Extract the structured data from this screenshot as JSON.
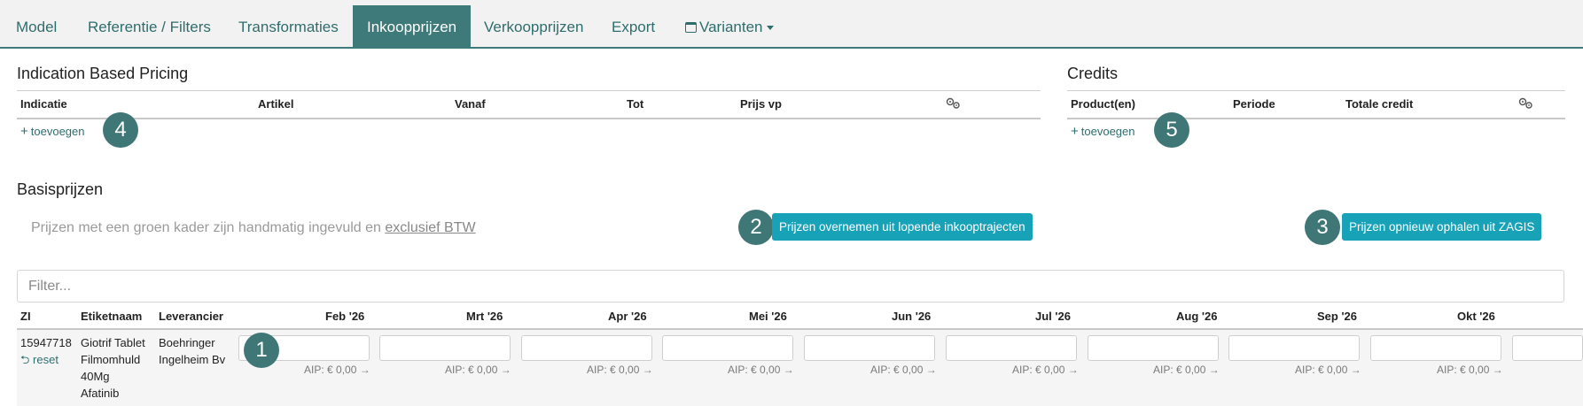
{
  "tabs": [
    {
      "label": "Model",
      "active": false
    },
    {
      "label": "Referentie / Filters",
      "active": false
    },
    {
      "label": "Transformaties",
      "active": false
    },
    {
      "label": "Inkoopprijzen",
      "active": true
    },
    {
      "label": "Verkoopprijzen",
      "active": false
    },
    {
      "label": "Export",
      "active": false
    },
    {
      "label": "Varianten",
      "active": false,
      "icon": "calendar-icon",
      "dropdown": true
    }
  ],
  "ibp": {
    "title": "Indication Based Pricing",
    "columns": [
      "Indicatie",
      "Artikel",
      "Vanaf",
      "Tot",
      "Prijs vp"
    ],
    "settings_icon": "gears-icon",
    "add_label": "toevoegen",
    "badge": "4"
  },
  "credits": {
    "title": "Credits",
    "columns": [
      "Product(en)",
      "Periode",
      "Totale credit"
    ],
    "settings_icon": "gears-icon",
    "add_label": "toevoegen",
    "badge": "5"
  },
  "basis": {
    "title": "Basisprijzen",
    "note_prefix": "Prijzen met een groen kader zijn handmatig ingevuld en ",
    "note_link": "exclusief BTW",
    "btn_overnemen": "Prijzen overnemen uit lopende inkooptrajecten",
    "btn_overnemen_badge": "2",
    "btn_zagis": "Prijzen opnieuw ophalen uit ZAGIS",
    "btn_zagis_badge": "3",
    "filter_placeholder": "Filter...",
    "columns": [
      "ZI",
      "Etiketnaam",
      "Leverancier"
    ],
    "months": [
      "Feb '26",
      "Mrt '26",
      "Apr '26",
      "Mei '26",
      "Jun '26",
      "Jul '26",
      "Aug '26",
      "Sep '26",
      "Okt '26"
    ],
    "row": {
      "zi": "15947718",
      "reset_label": "reset",
      "etiket_lines": [
        "Giotrif Tablet",
        "Filmomhuld",
        "40Mg",
        "Afatinib"
      ],
      "leverancier_lines": [
        "Boehringer",
        "Ingelheim Bv"
      ],
      "aip_label": "AIP: € 0,00",
      "row_badge": "1"
    }
  },
  "colors": {
    "accent": "#3f7a7a",
    "button": "#17a2b8",
    "badge": "#3e7776"
  }
}
